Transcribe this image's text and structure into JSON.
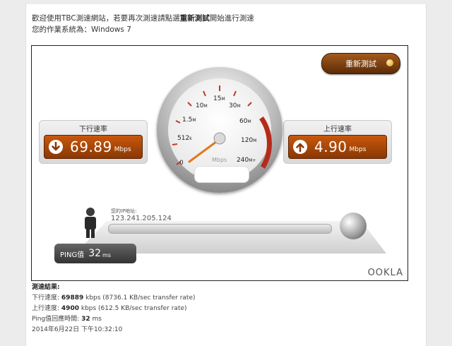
{
  "intro": {
    "line1_prefix": "歡迎使用TBC測速網站，若要再次測速請點選",
    "line1_bold": "重新測試",
    "line1_suffix": "開始進行測速",
    "line2": "您的作業系統為：Windows 7"
  },
  "restart_label": "重新測試",
  "download": {
    "label": "下行速率",
    "value": "69.89",
    "unit": "Mbps"
  },
  "upload": {
    "label": "上行速率",
    "value": "4.90",
    "unit": "Mbps"
  },
  "gauge": {
    "scale": {
      "s0": "0",
      "s0_5": "512",
      "s0_5k": "k",
      "s1_5": "1.5",
      "s1_5m": "M",
      "s10": "10",
      "s10m": "M",
      "s15": "15",
      "s15m": "M",
      "s30": "30",
      "s30m": "M",
      "s60": "60",
      "s60m": "M",
      "s120": "120",
      "s120m": "M",
      "s240": "240",
      "s240m": "M+"
    },
    "unit": "Mbps",
    "needle_value_mbps": 4.9
  },
  "network": {
    "ip_label": "您的IP地址:",
    "ip": "123.241.205.124"
  },
  "ping": {
    "label": "PING值",
    "value": "32",
    "unit": "ms"
  },
  "brand": "OOKLA",
  "results": {
    "heading": "測速結果:",
    "down_prefix": "下行速度:",
    "down_value": "69889",
    "down_suffix": "kbps (8736.1 KB/sec transfer rate)",
    "up_prefix": "上行速度:",
    "up_value": "4900",
    "up_suffix": "kbps (612.5 KB/sec transfer rate)",
    "ping_prefix": "Ping值回應時間:",
    "ping_value": "32",
    "ping_suffix": "ms",
    "timestamp": "2014年6月22日 下午10:32:10"
  },
  "colors": {
    "accent": "#c8580c",
    "dark_accent": "#5a2b08",
    "panel_border": "#222222"
  }
}
